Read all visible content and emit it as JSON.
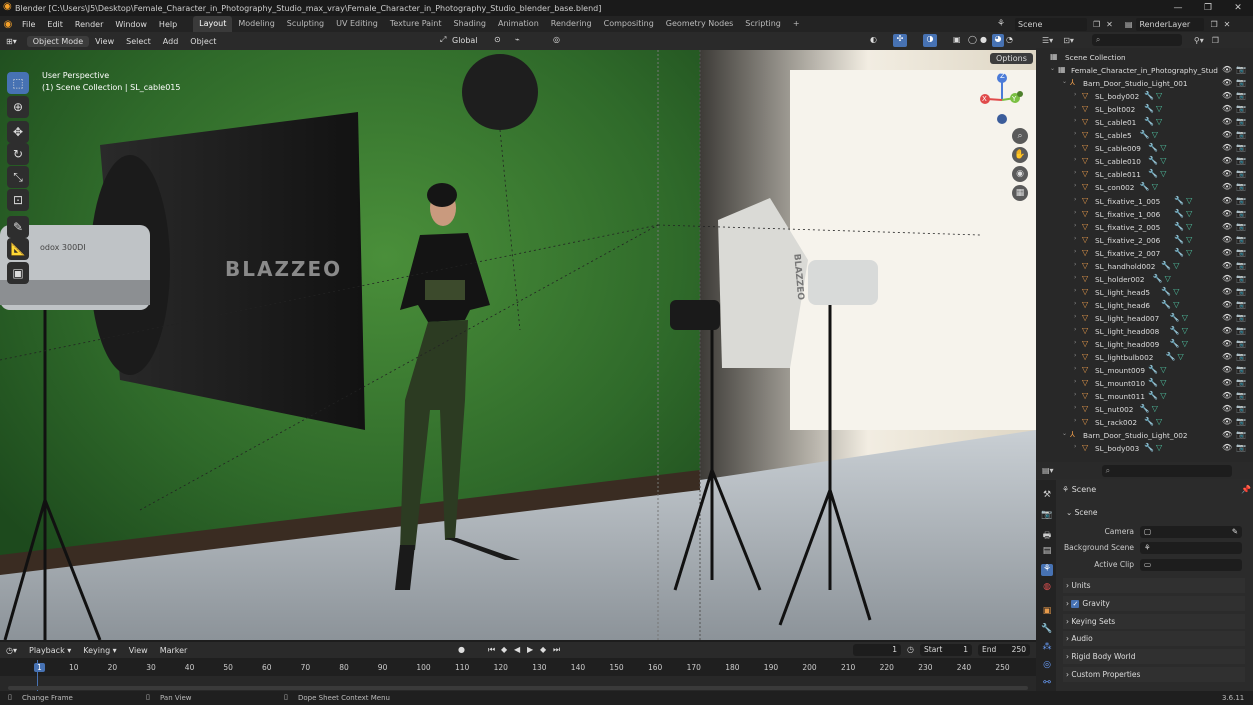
{
  "titlebar": {
    "title": "Blender [C:\\Users\\J5\\Desktop\\Female_Character_in_Photography_Studio_max_vray\\Female_Character_in_Photography_Studio_blender_base.blend]",
    "minimize": "—",
    "maximize": "❐",
    "close": "✕"
  },
  "menu": [
    "File",
    "Edit",
    "Render",
    "Window",
    "Help"
  ],
  "workspaces": [
    "Layout",
    "Modeling",
    "Sculpting",
    "UV Editing",
    "Texture Paint",
    "Shading",
    "Animation",
    "Rendering",
    "Compositing",
    "Geometry Nodes",
    "Scripting"
  ],
  "active_workspace": "Layout",
  "scene_field": "Scene",
  "view_layer": "RenderLayer",
  "viewport_header": {
    "mode": "Object Mode",
    "view": "View",
    "select": "Select",
    "add": "Add",
    "object": "Object",
    "orientation": "Global",
    "options": "Options"
  },
  "viewport_text": {
    "perspective": "User Perspective",
    "collection": "(1) Scene Collection | SL_cable015",
    "brand": "BLAZZEO",
    "brand2": "BLAZZEO",
    "brand_small": "odox 300DI"
  },
  "gizmo": {
    "z": "Z",
    "y": "Y",
    "x": "X"
  },
  "outliner": {
    "root": "Scene Collection",
    "items": [
      {
        "label": "Female_Character_in_Photography_Stud",
        "depth": 0,
        "type": "collection"
      },
      {
        "label": "Barn_Door_Studio_Light_001",
        "depth": 1,
        "type": "empty"
      },
      {
        "label": "SL_body002",
        "depth": 2,
        "type": "mesh"
      },
      {
        "label": "SL_bolt002",
        "depth": 2,
        "type": "mesh"
      },
      {
        "label": "SL_cable01",
        "depth": 2,
        "type": "mesh"
      },
      {
        "label": "SL_cable5",
        "depth": 2,
        "type": "mesh"
      },
      {
        "label": "SL_cable009",
        "depth": 2,
        "type": "mesh"
      },
      {
        "label": "SL_cable010",
        "depth": 2,
        "type": "mesh"
      },
      {
        "label": "SL_cable011",
        "depth": 2,
        "type": "mesh"
      },
      {
        "label": "SL_con002",
        "depth": 2,
        "type": "mesh"
      },
      {
        "label": "SL_fixative_1_005",
        "depth": 2,
        "type": "mesh"
      },
      {
        "label": "SL_fixative_1_006",
        "depth": 2,
        "type": "mesh"
      },
      {
        "label": "SL_fixative_2_005",
        "depth": 2,
        "type": "mesh"
      },
      {
        "label": "SL_fixative_2_006",
        "depth": 2,
        "type": "mesh"
      },
      {
        "label": "SL_fixative_2_007",
        "depth": 2,
        "type": "mesh"
      },
      {
        "label": "SL_handhold002",
        "depth": 2,
        "type": "mesh"
      },
      {
        "label": "SL_holder002",
        "depth": 2,
        "type": "mesh"
      },
      {
        "label": "SL_light_head5",
        "depth": 2,
        "type": "mesh"
      },
      {
        "label": "SL_light_head6",
        "depth": 2,
        "type": "mesh"
      },
      {
        "label": "SL_light_head007",
        "depth": 2,
        "type": "mesh"
      },
      {
        "label": "SL_light_head008",
        "depth": 2,
        "type": "mesh"
      },
      {
        "label": "SL_light_head009",
        "depth": 2,
        "type": "mesh"
      },
      {
        "label": "SL_lightbulb002",
        "depth": 2,
        "type": "mesh"
      },
      {
        "label": "SL_mount009",
        "depth": 2,
        "type": "mesh"
      },
      {
        "label": "SL_mount010",
        "depth": 2,
        "type": "mesh"
      },
      {
        "label": "SL_mount011",
        "depth": 2,
        "type": "mesh"
      },
      {
        "label": "SL_nut002",
        "depth": 2,
        "type": "mesh"
      },
      {
        "label": "SL_rack002",
        "depth": 2,
        "type": "mesh"
      },
      {
        "label": "Barn_Door_Studio_Light_002",
        "depth": 1,
        "type": "empty"
      },
      {
        "label": "SL_body003",
        "depth": 2,
        "type": "mesh"
      }
    ]
  },
  "properties": {
    "context": "Scene",
    "panel": "Scene",
    "camera_label": "Camera",
    "background_label": "Background Scene",
    "clip_label": "Active Clip",
    "sections": [
      "Units",
      "Gravity",
      "Keying Sets",
      "Audio",
      "Rigid Body World",
      "Custom Properties"
    ],
    "gravity_checked": true
  },
  "timeline": {
    "playback": "Playback",
    "keying": "Keying",
    "view": "View",
    "marker": "Marker",
    "current_frame": "1",
    "start_label": "Start",
    "start": "1",
    "end_label": "End",
    "end": "250",
    "ticks": [
      "1",
      "10",
      "20",
      "30",
      "40",
      "50",
      "60",
      "70",
      "80",
      "90",
      "100",
      "110",
      "120",
      "130",
      "140",
      "150",
      "160",
      "170",
      "180",
      "190",
      "200",
      "210",
      "220",
      "230",
      "240",
      "250"
    ]
  },
  "statusbar": {
    "left": "Change Frame",
    "middle": "Pan View",
    "right": "Dope Sheet Context Menu",
    "version": "3.6.11"
  },
  "colors": {
    "accent": "#4772b3",
    "green_screen": "#2f6a2a",
    "header": "#2a2a2a"
  }
}
